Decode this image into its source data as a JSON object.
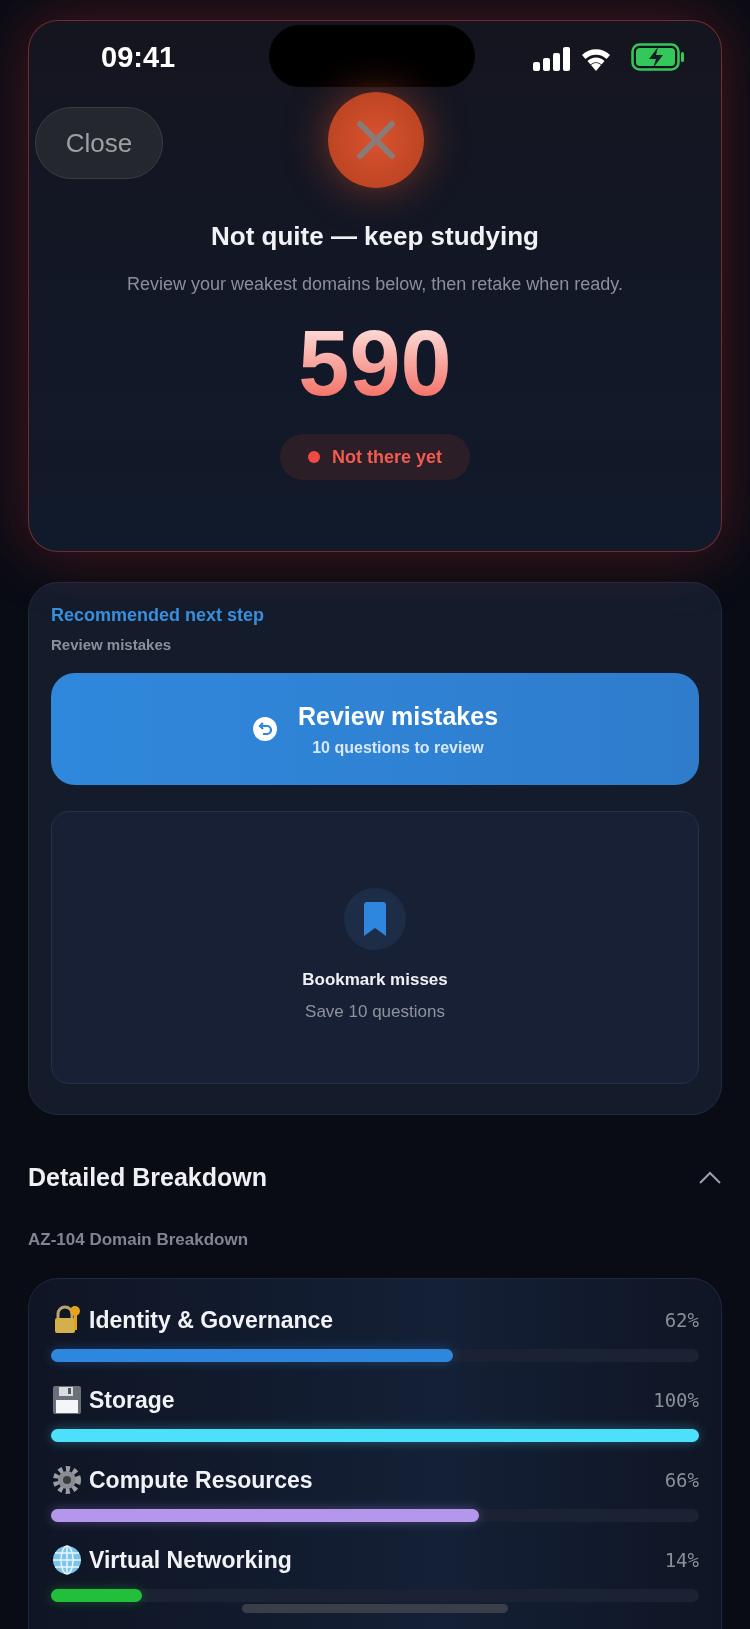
{
  "status_bar": {
    "time": "09:41"
  },
  "header": {
    "close_button": "Close",
    "title": "Not quite — keep studying",
    "subtitle": "Review your weakest domains below, then retake when ready.",
    "score": "590",
    "status_badge": "Not there yet"
  },
  "next_step": {
    "heading": "Recommended next step",
    "subheading": "Review mistakes",
    "primary_action": {
      "title": "Review mistakes",
      "subtitle": "10 questions to review"
    },
    "secondary_action": {
      "title": "Bookmark misses",
      "subtitle": "Save 10 questions"
    }
  },
  "breakdown": {
    "title": "Detailed Breakdown",
    "expanded": true,
    "subtitle": "AZ-104 Domain Breakdown",
    "domains": [
      {
        "name": "Identity & Governance",
        "percent": "62%",
        "level": 0.62,
        "color": "#2f86dd"
      },
      {
        "name": "Storage",
        "percent": "100%",
        "level": 1.0,
        "color": "#4de0fb"
      },
      {
        "name": "Compute Resources",
        "percent": "66%",
        "level": 0.66,
        "color": "#b497ec"
      },
      {
        "name": "Virtual Networking",
        "percent": "14%",
        "level": 0.14,
        "color": "#22c03a"
      }
    ]
  }
}
